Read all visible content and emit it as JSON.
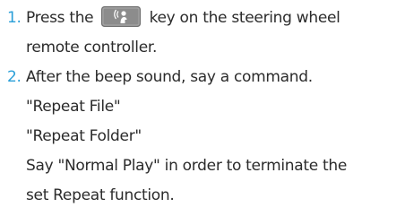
{
  "steps": [
    {
      "number": "1.",
      "before_icon": "Press the",
      "icon": "voice-recognition-key-icon",
      "after_icon": "key on the steering wheel",
      "continuation": "remote controller."
    },
    {
      "number": "2.",
      "text": "After the beep sound, say a command.",
      "commands": [
        "\"Repeat File\"",
        "\"Repeat Folder\""
      ],
      "note_line1": "Say \"Normal Play\" in order to terminate the",
      "note_line2": "set Repeat function."
    }
  ],
  "colors": {
    "step_number": "#2a9fd8",
    "key_fill": "#8c8c8c",
    "key_glyph": "#ffffff"
  }
}
